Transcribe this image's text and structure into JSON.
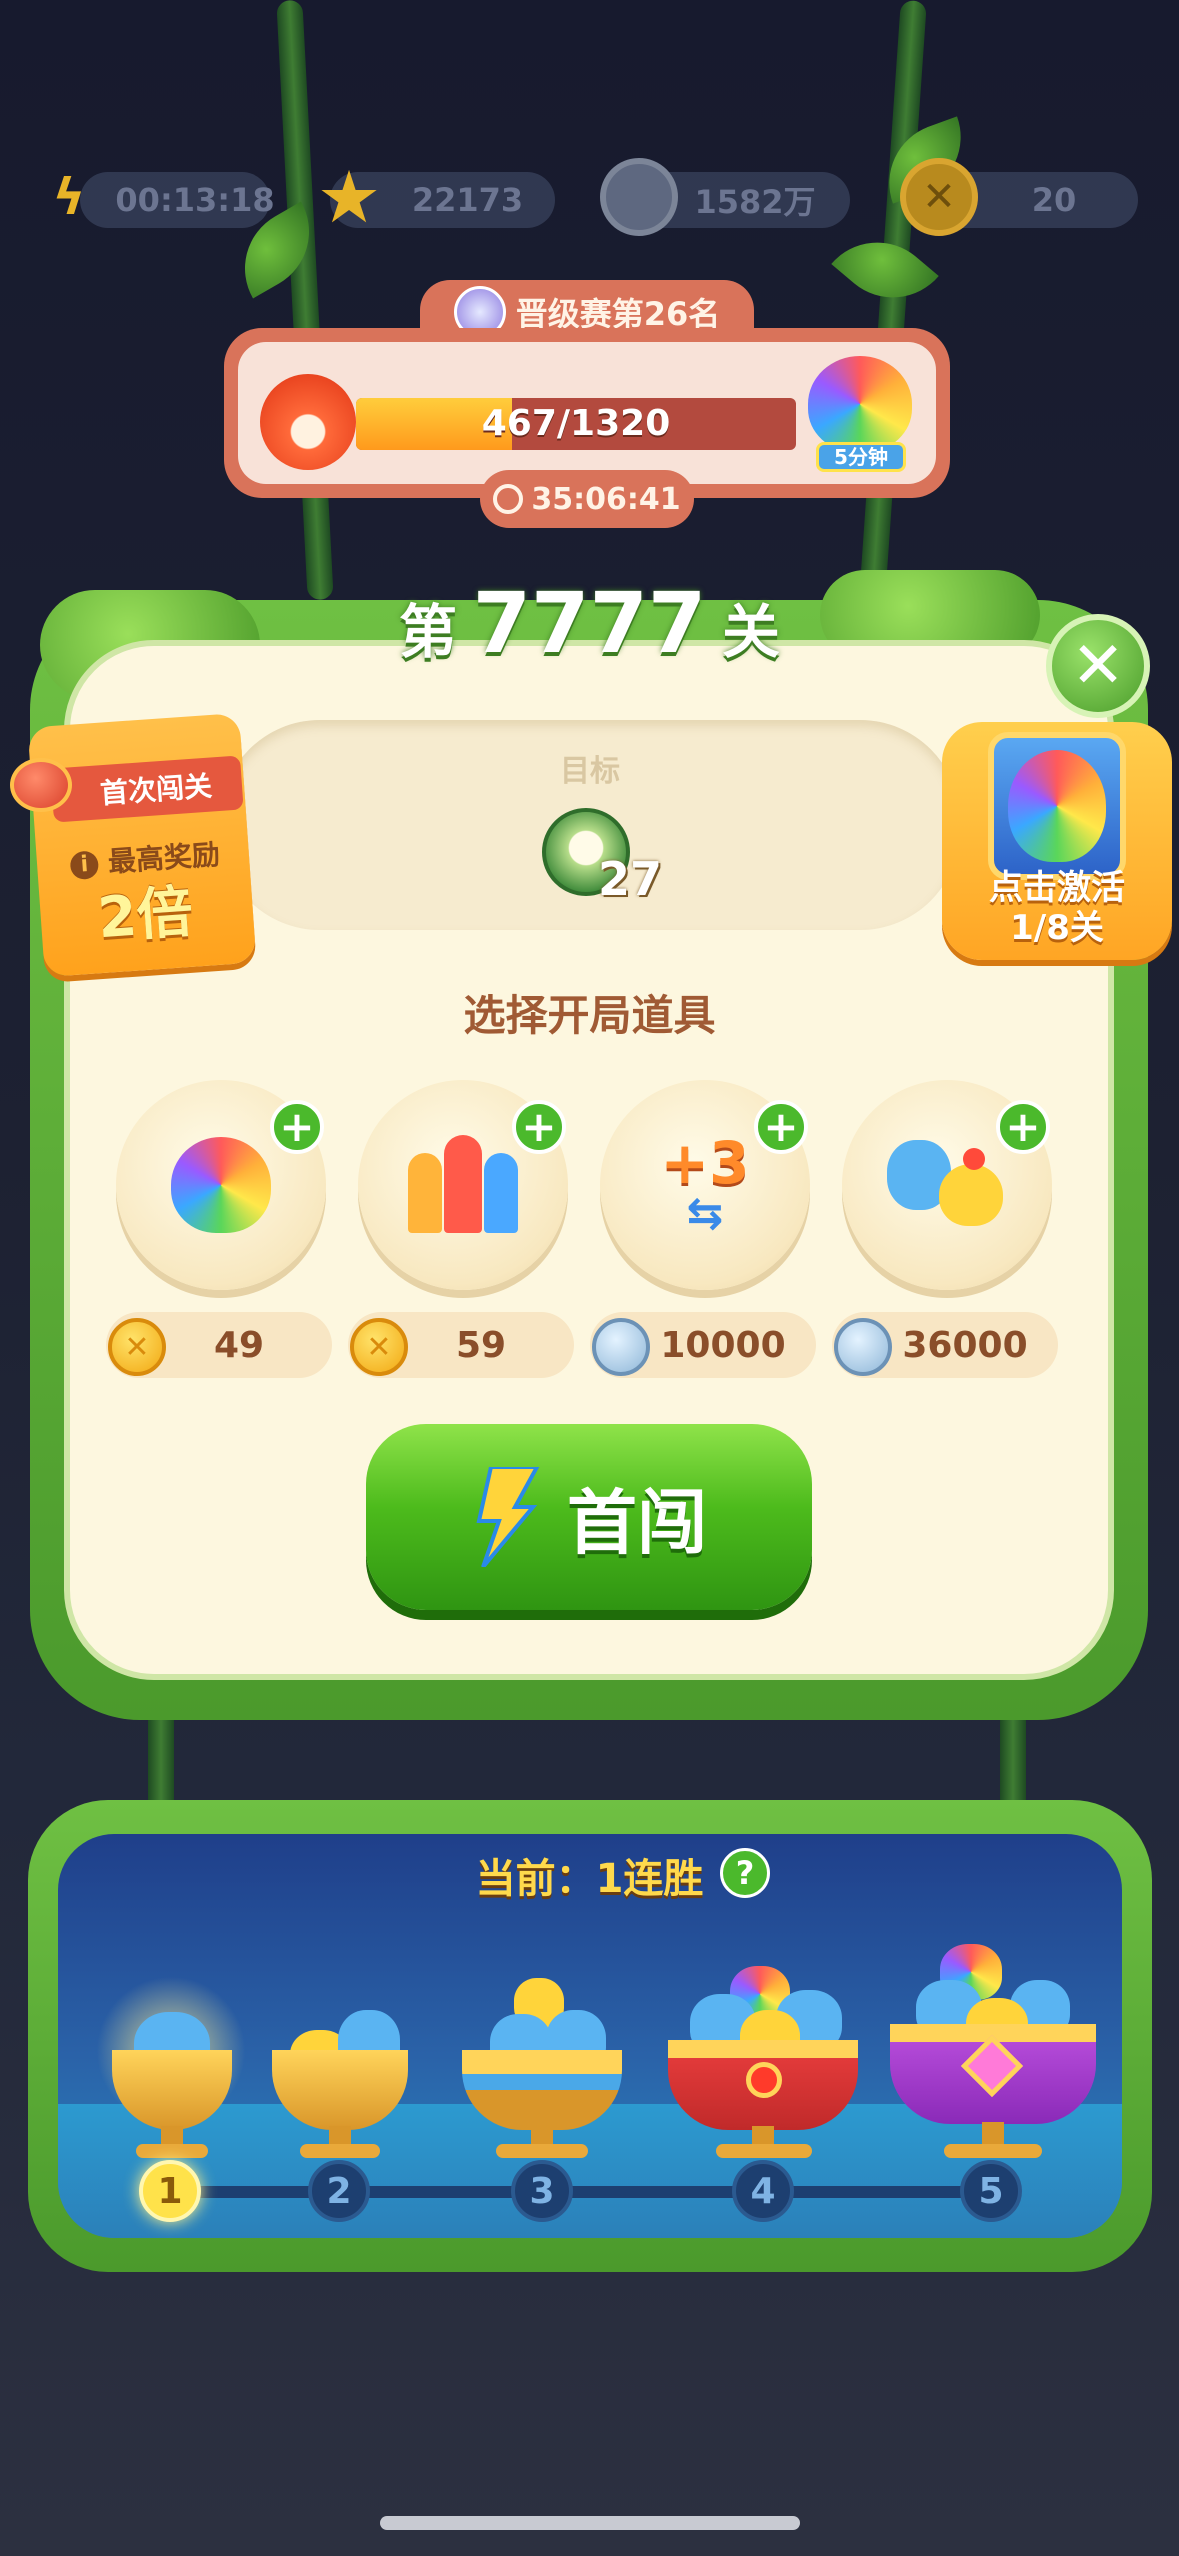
{
  "status_bar": {
    "energy_timer": "00:13:18",
    "stars": "22173",
    "silver_coins": "1582万",
    "gold_coins": "20"
  },
  "rank_banner": {
    "title": "晋级赛第26名",
    "progress_text": "467/1320",
    "progress_fraction": 0.354,
    "reward_time": "5分钟",
    "countdown": "35:06:41"
  },
  "level": {
    "prefix": "第",
    "number": "7777",
    "suffix": "关"
  },
  "goal": {
    "label": "目标",
    "count": "27"
  },
  "first_clear": {
    "title": "首次闯关",
    "info": "最高奖励",
    "multiplier": "2倍"
  },
  "activate": {
    "line1": "点击激活",
    "line2": "1/8关"
  },
  "boosters": {
    "title": "选择开局道具",
    "items": [
      {
        "icon": "rainbow-owl",
        "price": "49",
        "currency": "gold"
      },
      {
        "icon": "rockets",
        "price": "59",
        "currency": "gold"
      },
      {
        "icon": "plus-three-moves",
        "price": "10000",
        "currency": "silver"
      },
      {
        "icon": "blob-and-chick",
        "price": "36000",
        "currency": "silver"
      }
    ]
  },
  "play_button": {
    "label": "首闯"
  },
  "streak": {
    "title": "当前：1连胜",
    "help": "?",
    "nodes": [
      "1",
      "2",
      "3",
      "4",
      "5"
    ],
    "current": 1
  },
  "colors": {
    "green_frame": "#5aaa35",
    "board_bg": "#fdf7df",
    "rank_red": "#d9735a",
    "streak_blue": "#2a62a8"
  }
}
